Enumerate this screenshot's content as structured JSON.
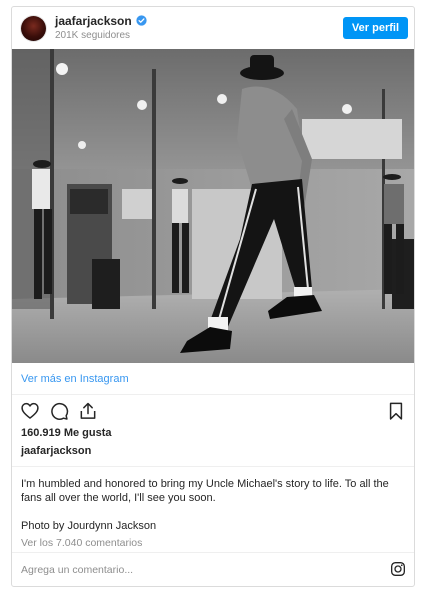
{
  "header": {
    "username": "jaafarjackson",
    "followers": "201K seguidores",
    "view_profile_label": "Ver perfil",
    "verified_icon": "verified-badge-icon"
  },
  "post": {
    "view_more_label": "Ver más en Instagram",
    "likes": "160.919 Me gusta",
    "owner": "jaafarjackson",
    "caption": "I'm humbled and honored to bring my Uncle Michael's story to life. To all the fans all over the world, I'll see you soon.",
    "credit": "Photo by Jourdynn Jackson",
    "comments_link": "Ver los 7.040 comentarios"
  },
  "actions": {
    "icons": [
      "heart-icon",
      "comment-icon",
      "share-icon",
      "bookmark-icon"
    ]
  },
  "comment_box": {
    "placeholder": "Agrega un comentario..."
  },
  "colors": {
    "accent": "#0095f6",
    "link": "#3897f0",
    "border": "#dbdbdb",
    "muted": "#8e8e8e"
  }
}
